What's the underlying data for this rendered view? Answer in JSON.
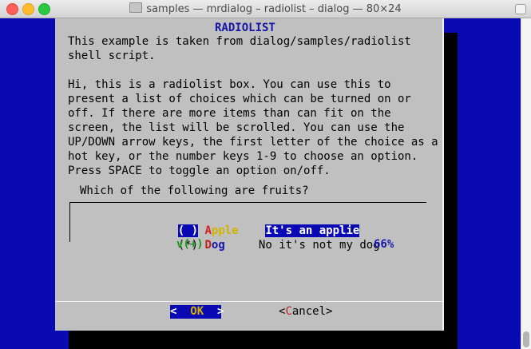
{
  "window": {
    "title": "samples — mrdialog – radiolist – dialog — 80×24"
  },
  "dialog": {
    "title": "RADIOLIST",
    "text_lines": [
      "This example is taken from dialog/samples/radiolist",
      "shell script.",
      "",
      "Hi, this is a radiolist box. You can use this to",
      "present a list of choices which can be turned on or",
      "off. If there are more items than can fit on the",
      "screen, the list will be scrolled. You can use the",
      "UP/DOWN arrow keys, the first letter of the choice as a",
      "hot key, or the number keys 1-9 to choose an option.",
      "Press SPACE to toggle an option on/off."
    ],
    "question": "Which of the following are fruits?",
    "items": [
      {
        "radio": "( )",
        "tag_hotkey": "A",
        "tag_rest": "pple",
        "item": "It's an applie",
        "selected": true
      },
      {
        "radio": "(*)",
        "tag_hotkey": "D",
        "tag_rest": "og",
        "item": "No it's not my dog",
        "selected": false
      }
    ],
    "more_indicator": "v(+)",
    "scroll_percent": "66%",
    "buttons": {
      "ok": {
        "left": "<",
        "hotkey": "OK",
        "right": ">"
      },
      "cancel": {
        "left": "<",
        "hotkey": "C",
        "rest": "ancel",
        "right": ">"
      }
    }
  }
}
